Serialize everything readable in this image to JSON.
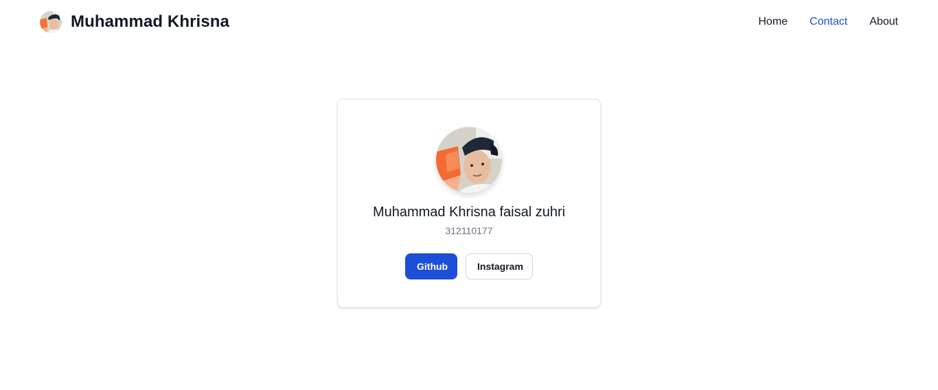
{
  "navbar": {
    "brand_title": "Muhammad Khrisna",
    "links": [
      {
        "label": "Home",
        "active": false
      },
      {
        "label": "Contact",
        "active": true
      },
      {
        "label": "About",
        "active": false
      }
    ]
  },
  "profile": {
    "name": "Muhammad Khrisna faisal zuhri",
    "id_number": "312110177",
    "buttons": {
      "github_label": "Github",
      "instagram_label": "Instagram"
    }
  },
  "icons": {
    "brand_avatar": "avatar-photo-icon",
    "profile_avatar": "avatar-photo-icon"
  },
  "colors": {
    "accent": "#1d4ed8",
    "text": "#111827",
    "muted": "#6b7280",
    "border": "#e5e7eb"
  }
}
